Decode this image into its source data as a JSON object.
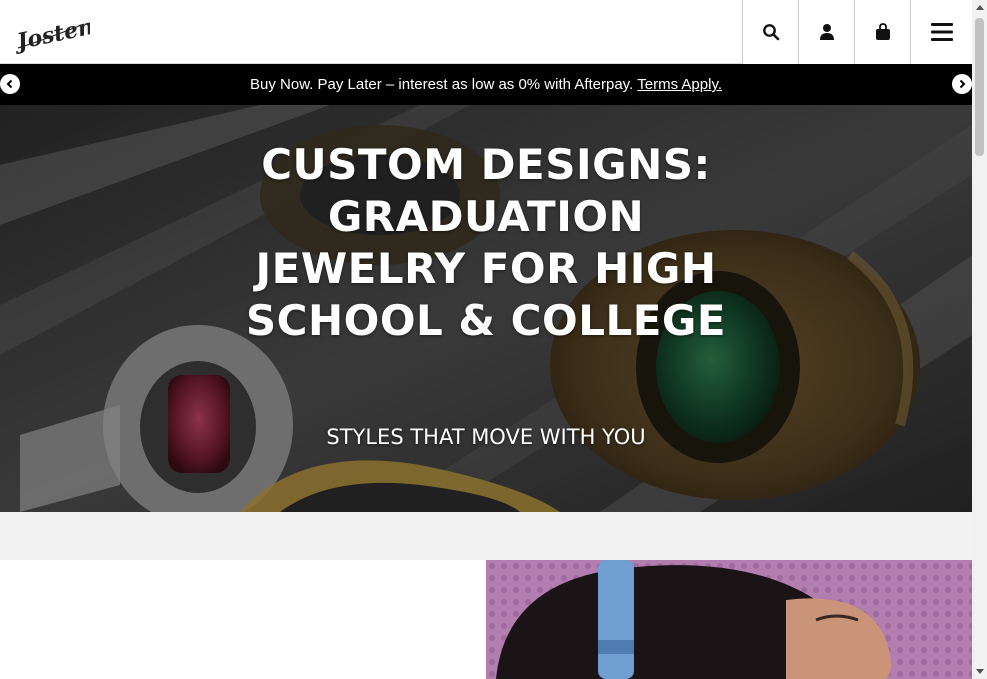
{
  "brand": {
    "logo_text": "Jostens"
  },
  "header": {
    "icons": [
      "search-icon",
      "account-icon",
      "bag-icon",
      "menu-icon"
    ]
  },
  "promo": {
    "message": "Buy Now. Pay Later – interest as low as 0% with Afterpay.",
    "terms_link": "Terms Apply."
  },
  "hero": {
    "title": "CUSTOM DESIGNS: GRADUATION JEWELRY FOR HIGH SCHOOL & COLLEGE",
    "subtitle": "STYLES THAT MOVE WITH YOU"
  },
  "colors": {
    "promo_bg": "#000000",
    "band_bg": "#f2f2f2",
    "promo_image_bg": "#b27eb0"
  }
}
